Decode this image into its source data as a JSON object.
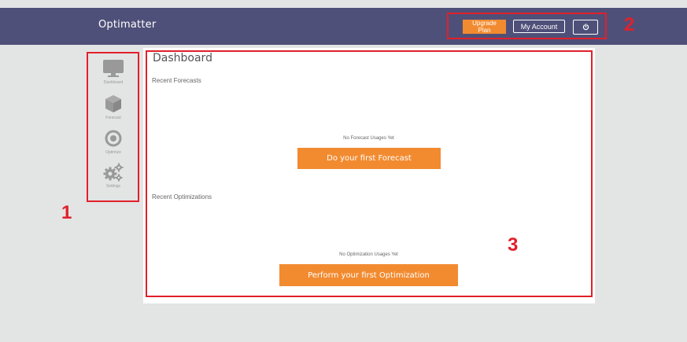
{
  "header": {
    "brand": "Optimatter",
    "upgrade_label": "Upgrade Plan",
    "account_label": "My Account",
    "power_icon": "power-icon",
    "bg_color": "#4f5079",
    "accent": "#f28b30"
  },
  "sidebar": {
    "items": [
      {
        "label": "Dashboard",
        "icon": "monitor-icon"
      },
      {
        "label": "Forecast",
        "icon": "cube-icon"
      },
      {
        "label": "Optimize",
        "icon": "target-icon"
      },
      {
        "label": "Settings",
        "icon": "gears-icon"
      }
    ]
  },
  "main": {
    "title": "Dashboard",
    "forecasts": {
      "heading": "Recent Forecasts",
      "empty_text": "No Forecast Usages Yet",
      "cta_label": "Do your first Forecast"
    },
    "optimizations": {
      "heading": "Recent Optimizations",
      "empty_text": "No Optimization Usages Yet",
      "cta_label": "Perform your first Optimization"
    }
  },
  "annotations": {
    "one": "1",
    "two": "2",
    "three": "3",
    "color": "#e1202a"
  }
}
